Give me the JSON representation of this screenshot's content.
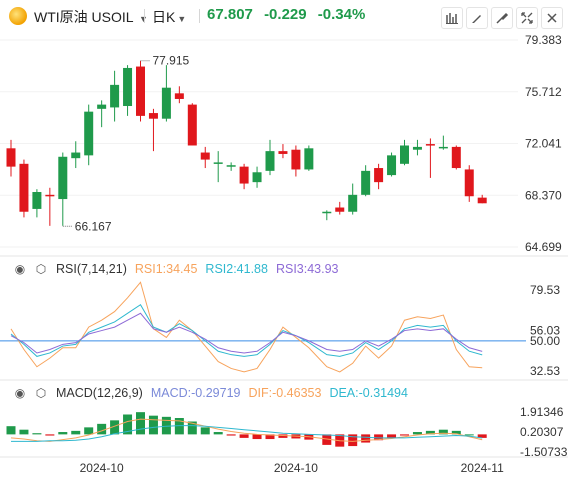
{
  "header": {
    "symbol": "WTI原油",
    "ticker": "USOIL",
    "period": "日K",
    "price": "67.807",
    "change": "-0.229",
    "change_pct": "-0.34%"
  },
  "toolbar": {
    "icons": [
      "chart-settings-icon",
      "pen-icon",
      "draw-tool-icon",
      "fullscreen-icon",
      "close-icon"
    ]
  },
  "colors": {
    "up": "#1f9a4b",
    "down": "#e0171c",
    "rsi1": "#f7a35c",
    "rsi2": "#2fb8cf",
    "rsi3": "#8d6ad6",
    "macd": "#7b8ad8",
    "dif": "#f7a35c",
    "dea": "#2fb8cf",
    "ref_line": "#3a8ee6"
  },
  "price_axis": {
    "labels": [
      "79.383",
      "75.712",
      "72.041",
      "68.370",
      "64.699"
    ],
    "current_label": "67.807"
  },
  "annotations": {
    "high": "77.915",
    "low": "66.167"
  },
  "rsi": {
    "title": "RSI(7,14,21)",
    "rsi1": "RSI1:34.45",
    "rsi2": "RSI2:41.88",
    "rsi3": "RSI3:43.93",
    "axis": [
      "79.53",
      "56.03",
      "50.00",
      "32.53"
    ]
  },
  "macd": {
    "title": "MACD(12,26,9)",
    "macd": "MACD:-0.29719",
    "dif": "DIF:-0.46353",
    "dea": "DEA:-0.31494",
    "axis": [
      "1.91346",
      "0.20307",
      "-1.50733"
    ]
  },
  "x_axis": [
    "2024-10",
    "2024-10",
    "2024-11"
  ],
  "chart_data": {
    "type": "candlestick",
    "ylim": [
      64.699,
      79.383
    ],
    "candles": [
      {
        "o": 71.7,
        "h": 72.3,
        "l": 69.7,
        "c": 70.4
      },
      {
        "o": 70.6,
        "h": 70.9,
        "l": 66.8,
        "c": 67.2
      },
      {
        "o": 67.4,
        "h": 68.8,
        "l": 66.8,
        "c": 68.6
      },
      {
        "o": 68.4,
        "h": 68.9,
        "l": 66.2,
        "c": 68.3
      },
      {
        "o": 68.1,
        "h": 71.4,
        "l": 66.2,
        "c": 71.1
      },
      {
        "o": 71.0,
        "h": 72.2,
        "l": 70.3,
        "c": 71.4
      },
      {
        "o": 71.2,
        "h": 74.8,
        "l": 70.5,
        "c": 74.3
      },
      {
        "o": 74.5,
        "h": 75.1,
        "l": 73.2,
        "c": 74.8
      },
      {
        "o": 74.6,
        "h": 77.2,
        "l": 73.6,
        "c": 76.2
      },
      {
        "o": 74.7,
        "h": 77.6,
        "l": 74.0,
        "c": 77.4
      },
      {
        "o": 77.5,
        "h": 77.9,
        "l": 73.6,
        "c": 74.0
      },
      {
        "o": 74.2,
        "h": 74.5,
        "l": 71.5,
        "c": 73.8
      },
      {
        "o": 73.8,
        "h": 77.6,
        "l": 73.6,
        "c": 76.0
      },
      {
        "o": 75.6,
        "h": 76.1,
        "l": 74.9,
        "c": 75.2
      },
      {
        "o": 74.8,
        "h": 74.9,
        "l": 71.9,
        "c": 71.9
      },
      {
        "o": 71.4,
        "h": 71.8,
        "l": 70.3,
        "c": 70.9
      },
      {
        "o": 70.7,
        "h": 71.5,
        "l": 69.3,
        "c": 70.7
      },
      {
        "o": 70.4,
        "h": 70.7,
        "l": 70.1,
        "c": 70.5
      },
      {
        "o": 70.4,
        "h": 70.6,
        "l": 68.8,
        "c": 69.2
      },
      {
        "o": 69.3,
        "h": 70.4,
        "l": 68.9,
        "c": 70.0
      },
      {
        "o": 70.1,
        "h": 72.3,
        "l": 69.8,
        "c": 71.5
      },
      {
        "o": 71.5,
        "h": 72.0,
        "l": 71.0,
        "c": 71.3
      },
      {
        "o": 71.6,
        "h": 71.9,
        "l": 69.7,
        "c": 70.2
      },
      {
        "o": 70.2,
        "h": 71.9,
        "l": 70.1,
        "c": 71.7
      },
      {
        "o": 67.2,
        "h": 67.3,
        "l": 66.6,
        "c": 67.2
      },
      {
        "o": 67.5,
        "h": 67.9,
        "l": 67.0,
        "c": 67.2
      },
      {
        "o": 67.2,
        "h": 69.2,
        "l": 67.0,
        "c": 68.4
      },
      {
        "o": 68.4,
        "h": 70.5,
        "l": 68.3,
        "c": 70.1
      },
      {
        "o": 70.3,
        "h": 70.6,
        "l": 68.8,
        "c": 69.3
      },
      {
        "o": 69.8,
        "h": 71.4,
        "l": 69.7,
        "c": 71.2
      },
      {
        "o": 70.6,
        "h": 72.3,
        "l": 70.5,
        "c": 71.9
      },
      {
        "o": 71.6,
        "h": 72.3,
        "l": 71.2,
        "c": 71.8
      },
      {
        "o": 72.0,
        "h": 72.4,
        "l": 69.6,
        "c": 71.9
      },
      {
        "o": 71.7,
        "h": 72.6,
        "l": 71.6,
        "c": 71.8
      },
      {
        "o": 71.8,
        "h": 71.9,
        "l": 70.2,
        "c": 70.3
      },
      {
        "o": 70.2,
        "h": 70.5,
        "l": 67.9,
        "c": 68.3
      },
      {
        "o": 68.2,
        "h": 68.4,
        "l": 67.8,
        "c": 67.8
      }
    ],
    "rsi1": [
      57,
      45,
      35,
      40,
      46,
      46,
      58,
      62,
      67,
      75,
      84,
      57,
      52,
      62,
      56,
      47,
      38,
      34,
      32,
      34,
      45,
      58,
      52,
      46,
      35,
      32,
      37,
      47,
      40,
      47,
      62,
      64,
      63,
      65,
      45,
      35,
      34.45
    ],
    "rsi2": [
      54,
      48,
      41,
      43,
      47,
      48,
      55,
      58,
      61,
      66,
      71,
      58,
      55,
      60,
      56,
      50,
      44,
      42,
      41,
      42,
      48,
      56,
      53,
      49,
      42,
      41,
      43,
      49,
      45,
      50,
      57,
      59,
      58,
      59,
      50,
      44,
      41.88
    ],
    "rsi3": [
      53,
      49,
      43,
      45,
      48,
      49,
      54,
      56,
      58,
      62,
      66,
      57,
      55,
      58,
      55,
      51,
      46,
      44,
      43,
      44,
      49,
      55,
      53,
      50,
      45,
      44,
      45,
      50,
      47,
      51,
      56,
      57,
      56,
      57,
      51,
      46,
      43.93
    ],
    "macd_hist": [
      0.7,
      0.4,
      0.1,
      -0.1,
      0.2,
      0.3,
      0.6,
      0.9,
      1.2,
      1.7,
      1.9,
      1.6,
      1.5,
      1.4,
      1.1,
      0.6,
      0.2,
      -0.1,
      -0.3,
      -0.4,
      -0.4,
      -0.3,
      -0.35,
      -0.45,
      -0.9,
      -1.05,
      -1.0,
      -0.7,
      -0.5,
      -0.3,
      -0.1,
      0.2,
      0.3,
      0.4,
      0.3,
      0.0,
      -0.3
    ],
    "dif": [
      -0.3,
      -0.4,
      -0.55,
      -0.6,
      -0.45,
      -0.3,
      -0.05,
      0.3,
      0.7,
      1.1,
      1.3,
      1.25,
      1.2,
      1.15,
      0.95,
      0.7,
      0.45,
      0.25,
      0.1,
      0.0,
      -0.05,
      -0.1,
      -0.15,
      -0.2,
      -0.4,
      -0.55,
      -0.6,
      -0.5,
      -0.45,
      -0.35,
      -0.2,
      -0.05,
      0.05,
      0.1,
      0.05,
      -0.2,
      -0.46
    ],
    "dea": [
      -0.6,
      -0.6,
      -0.6,
      -0.55,
      -0.55,
      -0.5,
      -0.4,
      -0.2,
      0.05,
      0.25,
      0.45,
      0.6,
      0.7,
      0.75,
      0.75,
      0.7,
      0.6,
      0.5,
      0.4,
      0.3,
      0.2,
      0.1,
      0.05,
      0.0,
      -0.05,
      -0.1,
      -0.2,
      -0.25,
      -0.3,
      -0.3,
      -0.3,
      -0.25,
      -0.2,
      -0.15,
      -0.1,
      -0.15,
      -0.31
    ]
  }
}
